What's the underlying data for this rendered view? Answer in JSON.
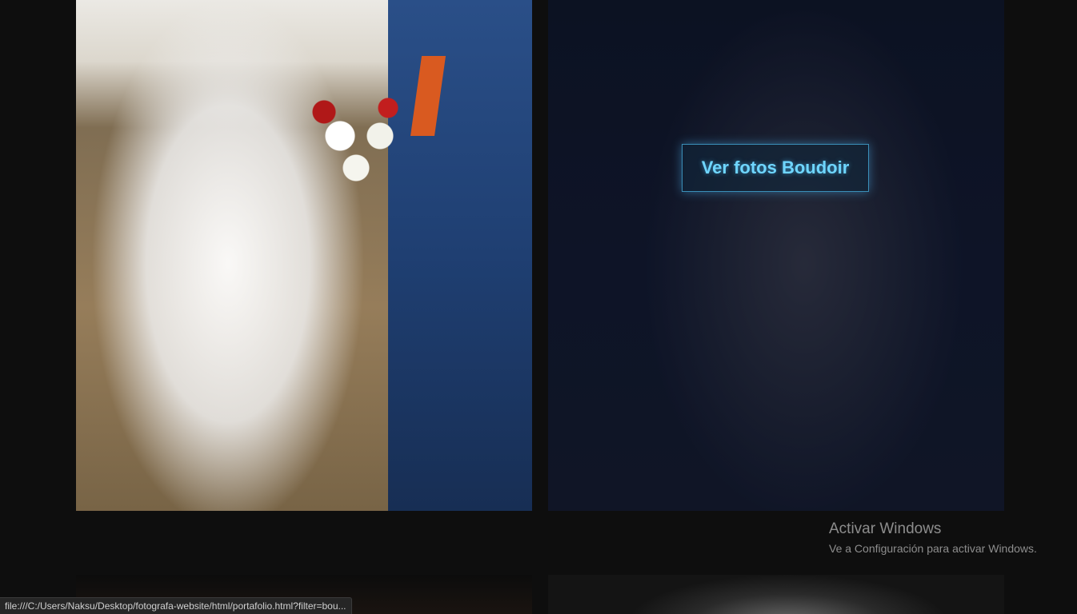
{
  "gallery": {
    "wedding": {
      "alt": ""
    },
    "boudoir": {
      "cta_label": "Ver fotos Boudoir"
    }
  },
  "watermark": {
    "title": "Activar Windows",
    "subtitle": "Ve a Configuración para activar Windows."
  },
  "statusbar": {
    "url": "file:///C:/Users/Naksu/Desktop/fotografa-website/html/portafolio.html?filter=bou..."
  },
  "colors": {
    "background": "#0e0e0e",
    "cta_text": "#6fd6ff",
    "cta_border": "#3a8fb8"
  }
}
